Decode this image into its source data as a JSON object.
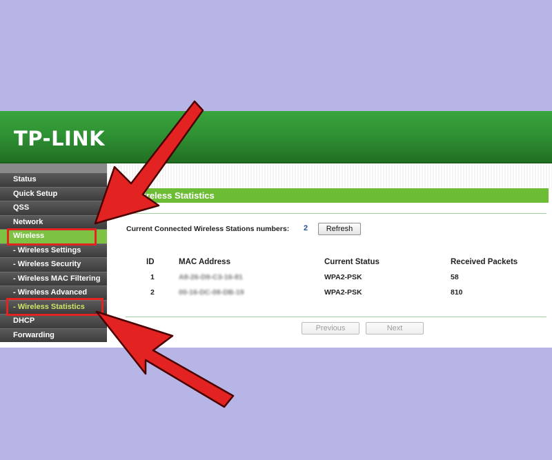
{
  "brand": {
    "logo": "TP-LINK"
  },
  "sidebar": {
    "items": [
      {
        "label": "Status"
      },
      {
        "label": "Quick Setup"
      },
      {
        "label": "QSS"
      },
      {
        "label": "Network"
      },
      {
        "label": "Wireless"
      },
      {
        "label": "- Wireless Settings"
      },
      {
        "label": "- Wireless Security"
      },
      {
        "label": "- Wireless MAC Filtering"
      },
      {
        "label": "- Wireless Advanced"
      },
      {
        "label": "- Wireless Statistics"
      },
      {
        "label": "DHCP"
      },
      {
        "label": "Forwarding"
      }
    ]
  },
  "main": {
    "section_title": "Wireless Statistics",
    "count_label": "Current Connected Wireless Stations numbers:",
    "count_value": "2",
    "refresh_label": "Refresh",
    "table": {
      "headers": [
        "ID",
        "MAC Address",
        "Current Status",
        "Received Packets"
      ],
      "rows": [
        {
          "id": "1",
          "mac": "A8-26-D9-C3-16-81",
          "status": "WPA2-PSK",
          "packets": "58"
        },
        {
          "id": "2",
          "mac": "00-16-DC-08-DB-19",
          "status": "WPA2-PSK",
          "packets": "810"
        }
      ]
    },
    "previous_label": "Previous",
    "next_label": "Next"
  },
  "colors": {
    "background": "#b7b5e5",
    "header_green": "#2f9234",
    "section_green": "#6dbc36",
    "active_nav": "#7dc242",
    "annotation_red": "#e32222"
  }
}
